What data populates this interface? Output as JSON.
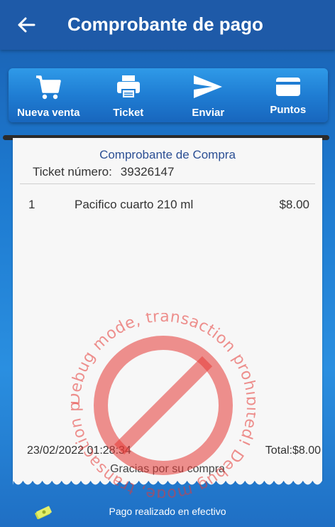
{
  "appbar": {
    "title": "Comprobante de pago",
    "back_icon": "arrow-left-icon"
  },
  "toolbar": {
    "items": [
      {
        "label": "Nueva venta",
        "icon": "shopping-cart-icon"
      },
      {
        "label": "Ticket",
        "icon": "printer-icon"
      },
      {
        "label": "Enviar",
        "icon": "send-icon"
      },
      {
        "label": "Puntos",
        "icon": "card-icon"
      }
    ]
  },
  "receipt": {
    "title": "Comprobante de Compra",
    "ticket_label": "Ticket número:",
    "ticket_number": "39326147",
    "items": [
      {
        "qty": "1",
        "name": "Pacifico cuarto 210 ml",
        "price": "$8.00"
      }
    ],
    "datetime": "23/02/2022 01:28:34",
    "total": "Total:$8.00",
    "thanks": "Gracias por su compra"
  },
  "footer": {
    "payment_text": "Pago realizado en efectivo",
    "icon": "cash-icon"
  },
  "watermark": {
    "text": "Debug mode, transaction prohibited! Debug mode, transaction prohibited!",
    "icon": "prohibited-icon"
  },
  "colors": {
    "appbar": "#1e5aa8",
    "receipt_title": "#2b4f94",
    "watermark": "#e53935"
  }
}
